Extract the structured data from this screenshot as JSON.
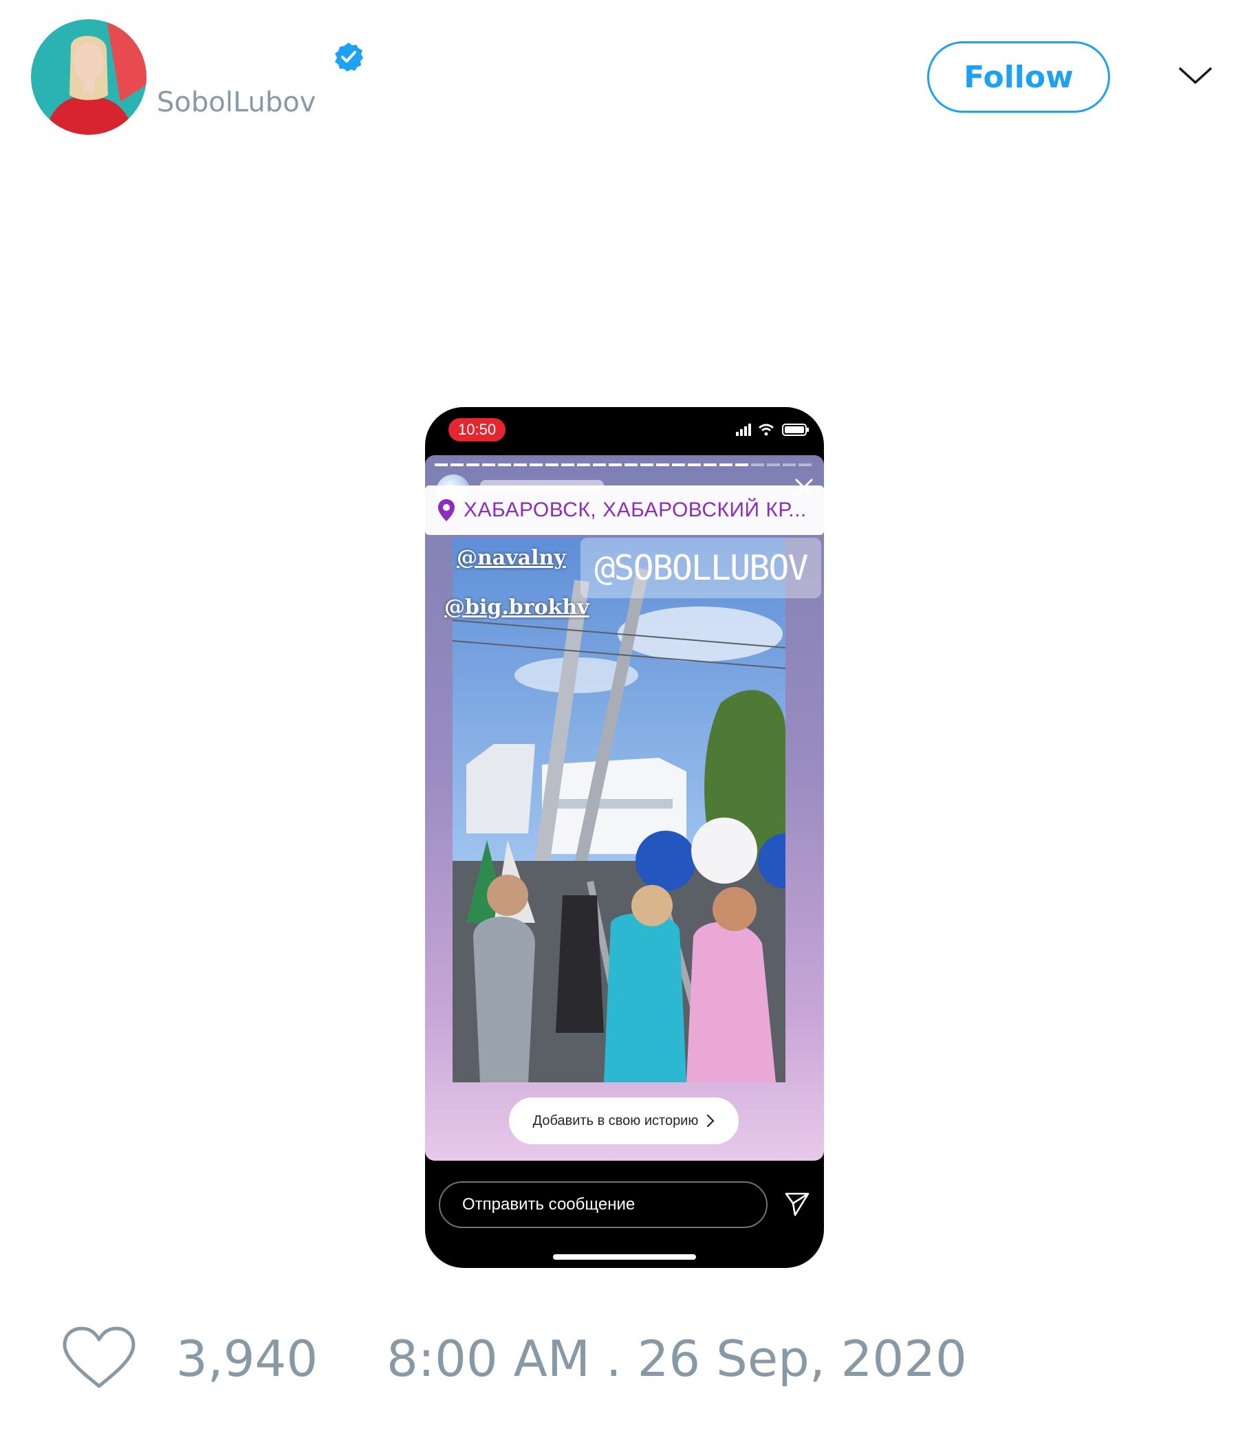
{
  "header": {
    "display_name": "",
    "handle": "SobolLubov",
    "follow_label": "Follow",
    "colors": {
      "accent": "#1da1f2",
      "muted": "#8899a6",
      "verified": "#1da1f2"
    }
  },
  "media": {
    "status_time": "10:50",
    "location": "ХАБАРОВСК, ХАБАРОВСКИЙ КР...",
    "mentions": [
      "@navalny",
      "@big.brokhv"
    ],
    "handle_sticker": "@SOBOLLUBOV",
    "add_story_label": "Добавить в свою историю",
    "message_placeholder": "Отправить сообщение",
    "colors": {
      "status_time_bg": "#e4262f",
      "location_text": "#8c2dbf"
    }
  },
  "footer": {
    "like_count": "3,940",
    "timestamp": "8:00 AM . 26 Sep, 2020"
  }
}
